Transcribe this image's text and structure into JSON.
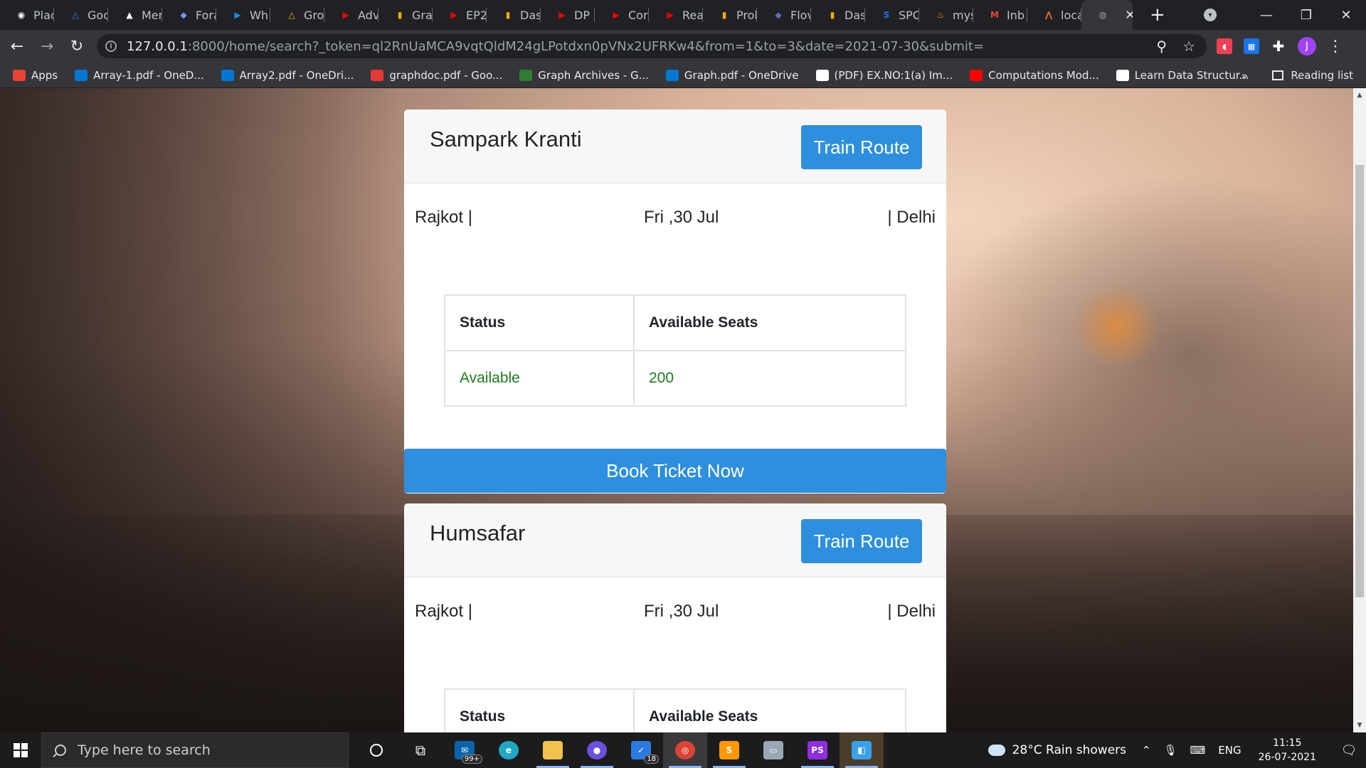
{
  "browser": {
    "tabs": [
      {
        "label": "Plac",
        "icon": "github-icon",
        "color": "#ffffff",
        "glyph": "◉"
      },
      {
        "label": "Goo",
        "icon": "google-drive-icon",
        "color": "#4285f4",
        "glyph": "△"
      },
      {
        "label": "Mer",
        "icon": "mountain-icon",
        "color": "#ffffff",
        "glyph": "▲"
      },
      {
        "label": "Fora",
        "icon": "shield-icon",
        "color": "#7b8cff",
        "glyph": "◆"
      },
      {
        "label": "Wh",
        "icon": "video-icon",
        "color": "#1e88e5",
        "glyph": "▶"
      },
      {
        "label": "Gro",
        "icon": "google-drive-icon",
        "color": "#fbbc04",
        "glyph": "△"
      },
      {
        "label": "Adv",
        "icon": "youtube-icon",
        "color": "#ff0000",
        "glyph": "▶"
      },
      {
        "label": "Gra",
        "icon": "bar-chart-icon",
        "color": "#f9ab00",
        "glyph": "▮"
      },
      {
        "label": "EP2",
        "icon": "youtube-icon",
        "color": "#ff0000",
        "glyph": "▶"
      },
      {
        "label": "Das",
        "icon": "bar-chart-icon",
        "color": "#f9ab00",
        "glyph": "▮"
      },
      {
        "label": "DP",
        "icon": "youtube-icon",
        "color": "#ff0000",
        "glyph": "▶"
      },
      {
        "label": "Cor",
        "icon": "youtube-icon",
        "color": "#ff0000",
        "glyph": "▶"
      },
      {
        "label": "Rea",
        "icon": "youtube-icon",
        "color": "#ff0000",
        "glyph": "▶"
      },
      {
        "label": "Prol",
        "icon": "bar-chart-icon",
        "color": "#f9ab00",
        "glyph": "▮"
      },
      {
        "label": "Flov",
        "icon": "cube-icon",
        "color": "#5c6bc0",
        "glyph": "◆"
      },
      {
        "label": "Das",
        "icon": "bar-chart-icon",
        "color": "#f9ab00",
        "glyph": "▮"
      },
      {
        "label": "SPC",
        "icon": "s-logo-icon",
        "color": "#1a73e8",
        "glyph": "S"
      },
      {
        "label": "mys",
        "icon": "fire-icon",
        "color": "#ff9800",
        "glyph": "♨"
      },
      {
        "label": "Inb",
        "icon": "gmail-icon",
        "color": "#ea4335",
        "glyph": "M"
      },
      {
        "label": "loca",
        "icon": "xampp-icon",
        "color": "#fb7a24",
        "glyph": "⋀"
      }
    ],
    "active_tab": {
      "icon": "globe-icon",
      "close": "✕"
    },
    "new_tab": "+",
    "window": {
      "minimize": "—",
      "restore": "❐",
      "close": "✕"
    },
    "url_host": "127.0.0.1",
    "url_rest": ":8000/home/search?_token=ql2RnUaMCA9vqtQldM24gLPotdxn0pVNx2UFRKw4&from=1&to=3&date=2021-07-30&submit=",
    "avatar_letter": "J",
    "bookmarks": [
      {
        "label": "Apps",
        "icon": "apps-grid-icon",
        "color": "#ea4335"
      },
      {
        "label": "Array-1.pdf - OneD...",
        "icon": "onedrive-icon",
        "color": "#0078d4"
      },
      {
        "label": "Array2.pdf - OneDri...",
        "icon": "onedrive-icon",
        "color": "#0078d4"
      },
      {
        "label": "graphdoc.pdf - Goo...",
        "icon": "pdf-icon",
        "color": "#e53935"
      },
      {
        "label": "Graph Archives - G...",
        "icon": "gg-icon",
        "color": "#2e7d32"
      },
      {
        "label": "Graph.pdf - OneDrive",
        "icon": "onedrive-icon",
        "color": "#0078d4"
      },
      {
        "label": "(PDF) EX.NO:1(a) Im...",
        "icon": "academia-icon",
        "color": "#ffffff"
      },
      {
        "label": "Computations Mod...",
        "icon": "youtube-icon",
        "color": "#ff0000"
      },
      {
        "label": "Learn Data Structur...",
        "icon": "cc-icon",
        "color": "#ffffff"
      }
    ],
    "bookmarks_more": "»",
    "reading_list": "Reading list"
  },
  "trains": [
    {
      "name": "Sampark Kranti",
      "route_button": "Train Route",
      "source": "Rajkot |",
      "date": "Fri ,30 Jul",
      "destination": "| Delhi",
      "status_header": "Status",
      "seats_header": "Available Seats",
      "status": "Available",
      "seats": "200",
      "book_button": "Book Ticket Now"
    },
    {
      "name": "Humsafar",
      "route_button": "Train Route",
      "source": "Rajkot |",
      "date": "Fri ,30 Jul",
      "destination": "| Delhi",
      "status_header": "Status",
      "seats_header": "Available Seats"
    }
  ],
  "taskbar": {
    "search_placeholder": "Type here to search",
    "mail_badge": "99+",
    "todo_badge": "18",
    "weather": "28°C  Rain showers",
    "language": "ENG",
    "time": "11:15",
    "date": "26-07-2021"
  }
}
